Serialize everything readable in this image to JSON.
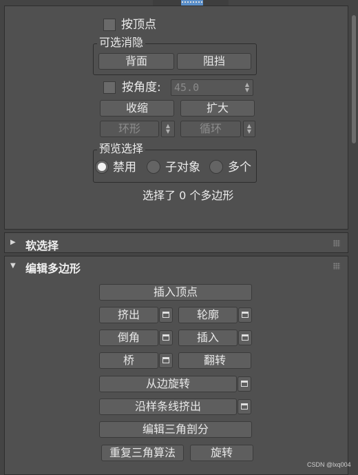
{
  "top": {
    "by_vertex_label": "按顶点",
    "culling_group_title": "可选消隐",
    "backface_button": "背面",
    "occluded_button": "阻挡",
    "by_angle_label": "按角度:",
    "angle_value": "45.0",
    "shrink_button": "收缩",
    "grow_button": "扩大",
    "ring_button": "环形",
    "loop_button": "循环",
    "preview_group_title": "预览选择",
    "preview_options": [
      "禁用",
      "子对象",
      "多个"
    ],
    "preview_selected": "禁用",
    "selection_status": "选择了 0 个多边形"
  },
  "soft_selection": {
    "title": "软选择",
    "collapsed": true
  },
  "edit_polygons": {
    "title": "编辑多边形",
    "insert_vertex": "插入顶点",
    "extrude": "挤出",
    "outline": "轮廓",
    "bevel": "倒角",
    "inset": "插入",
    "bridge": "桥",
    "flip": "翻转",
    "hinge_from_edge": "从边旋转",
    "extrude_along_spline": "沿样条线挤出",
    "edit_triangulation": "编辑三角剖分",
    "retriangulate": "重复三角算法",
    "turn": "旋转"
  },
  "watermark": "CSDN @lxq004",
  "colors": {
    "background": "#444444",
    "panel": "#505050",
    "button": "#5e5e5e",
    "accent_tab": "#5b8fc9"
  }
}
